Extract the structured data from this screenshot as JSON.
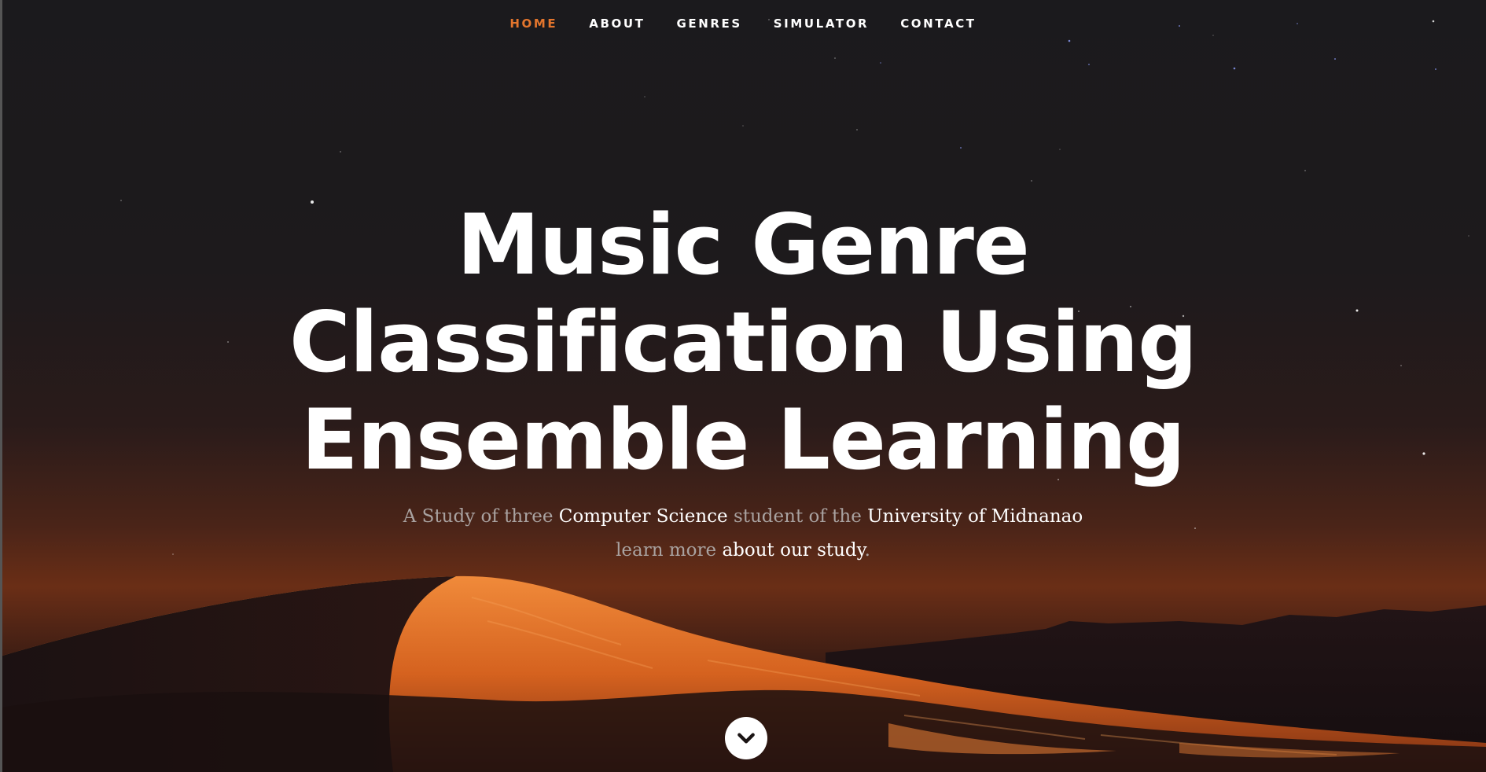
{
  "nav": {
    "items": [
      {
        "label": "HOME",
        "active": true
      },
      {
        "label": "ABOUT",
        "active": false
      },
      {
        "label": "GENRES",
        "active": false
      },
      {
        "label": "SIMULATOR",
        "active": false
      },
      {
        "label": "CONTACT",
        "active": false
      }
    ]
  },
  "hero": {
    "title_line1": "Music Genre",
    "title_line2": "Classification Using",
    "title_line3": "Ensemble Learning",
    "subtitle": {
      "part1": "A Study of three ",
      "link1": "Computer Science",
      "part2": " student of the ",
      "link2": "University of Midnanao",
      "part3": "learn more ",
      "link3": "about our study",
      "part4": "."
    }
  },
  "scroll_button": {
    "icon": "chevron-down-icon"
  },
  "colors": {
    "accent": "#e3752d",
    "text": "#ffffff",
    "muted": "#a9a2a0",
    "sand": "#d9702a"
  }
}
